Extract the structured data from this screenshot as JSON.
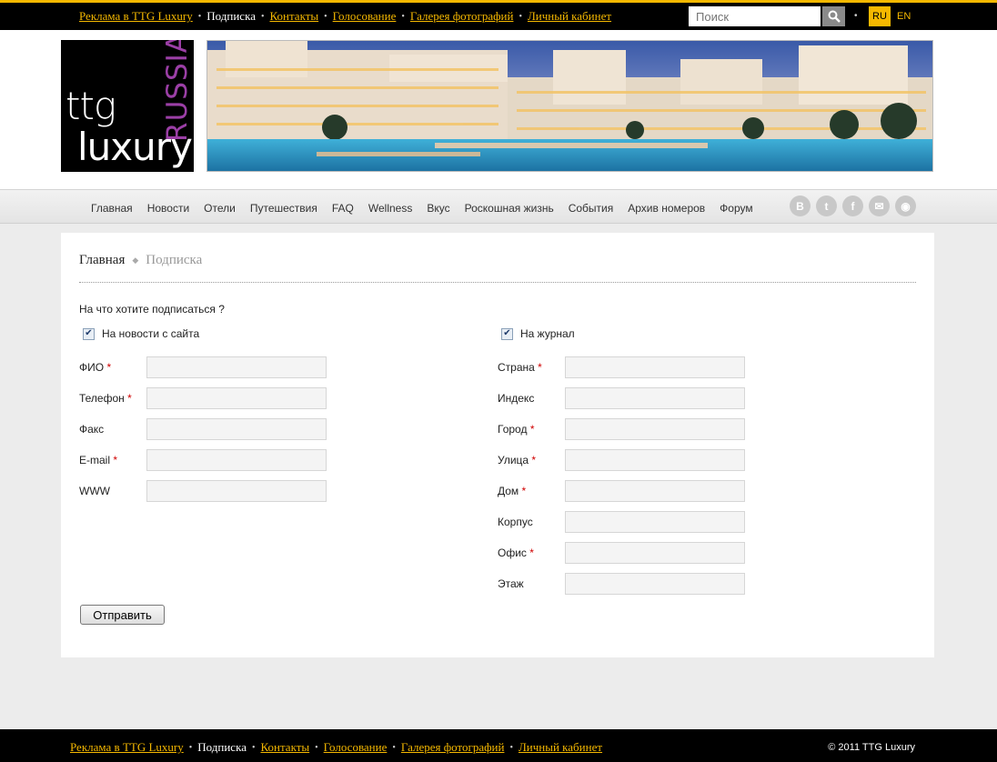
{
  "top_nav": {
    "links": [
      {
        "label": "Реклама в TTG Luxury",
        "current": false
      },
      {
        "label": "Подписка",
        "current": true
      },
      {
        "label": "Контакты",
        "current": false
      },
      {
        "label": "Голосование",
        "current": false
      },
      {
        "label": "Галерея фотографий",
        "current": false
      },
      {
        "label": "Личный кабинет",
        "current": false
      }
    ],
    "search_placeholder": "Поиск",
    "lang_ru": "RU",
    "lang_en": "EN"
  },
  "logo": {
    "line1": "ttg",
    "line2": "luxury",
    "vertical": "RUSSIA"
  },
  "main_nav": [
    "Главная",
    "Новости",
    "Отели",
    "Путешествия",
    "FAQ",
    "Wellness",
    "Вкус",
    "Роскошная жизнь",
    "События",
    "Архив номеров",
    "Форум"
  ],
  "socials": [
    {
      "icon": "vkontakte-icon",
      "glyph": "B"
    },
    {
      "icon": "twitter-icon",
      "glyph": "t"
    },
    {
      "icon": "facebook-icon",
      "glyph": "f"
    },
    {
      "icon": "mail-icon",
      "glyph": "✉"
    },
    {
      "icon": "rss-icon",
      "glyph": "◉"
    }
  ],
  "breadcrumb": {
    "home": "Главная",
    "current": "Подписка"
  },
  "form": {
    "question": "На что хотите подписаться ?",
    "check_news": "На новости с сайта",
    "check_magazine": "На журнал",
    "left_fields": [
      {
        "label": "ФИО",
        "required": "*"
      },
      {
        "label": "Телефон",
        "required": "*"
      },
      {
        "label": "Факс",
        "required": ""
      },
      {
        "label": "E-mail",
        "required": "*"
      },
      {
        "label": "WWW",
        "required": ""
      }
    ],
    "right_fields": [
      {
        "label": "Страна",
        "required": "*"
      },
      {
        "label": "Индекс",
        "required": ""
      },
      {
        "label": "Город",
        "required": "*"
      },
      {
        "label": "Улица",
        "required": "*"
      },
      {
        "label": "Дом",
        "required": "*"
      },
      {
        "label": "Корпус",
        "required": ""
      },
      {
        "label": "Офис",
        "required": "*"
      },
      {
        "label": "Этаж",
        "required": ""
      }
    ],
    "submit": "Отправить"
  },
  "footer": {
    "links": [
      {
        "label": "Реклама в TTG Luxury",
        "current": false
      },
      {
        "label": "Подписка",
        "current": true
      },
      {
        "label": "Контакты",
        "current": false
      },
      {
        "label": "Голосование",
        "current": false
      },
      {
        "label": "Галерея фотографий",
        "current": false
      },
      {
        "label": "Личный кабинет",
        "current": false
      }
    ],
    "copyright": "© 2011 TTG Luxury"
  },
  "colors": {
    "accent": "#f5b800",
    "logo_russia": "#9b3fa6",
    "required": "#d00000"
  }
}
